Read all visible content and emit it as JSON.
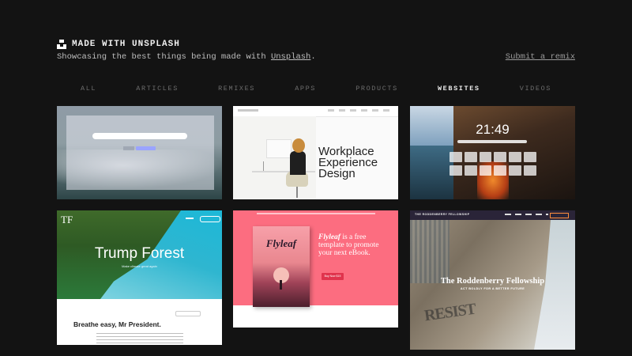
{
  "header": {
    "title": "MADE WITH UNSPLASH",
    "tagline_prefix": "Showcasing the best things being made with ",
    "tagline_link": "Unsplash",
    "tagline_suffix": ".",
    "submit_label": "Submit a remix"
  },
  "tabs": [
    {
      "label": "ALL",
      "active": false
    },
    {
      "label": "ARTICLES",
      "active": false
    },
    {
      "label": "REMIXES",
      "active": false
    },
    {
      "label": "APPS",
      "active": false
    },
    {
      "label": "PRODUCTS",
      "active": false
    },
    {
      "label": "WEBSITES",
      "active": true
    },
    {
      "label": "VIDEOS",
      "active": false
    }
  ],
  "cards": {
    "c2": {
      "headline": "Workplace Experience Design"
    },
    "c3": {
      "clock": "21:49"
    },
    "c4": {
      "logo": "TF",
      "title": "Trump Forest",
      "subtitle": "Make climate great again",
      "heading": "Breathe easy, Mr President."
    },
    "c5": {
      "book_title": "Flyleaf",
      "headline_italic": "Flyleaf",
      "headline_rest": " is a free template to promote your next eBook.",
      "cta": "Buy Now $15"
    },
    "c6": {
      "brand": "THE RODDENBERRY FELLOWSHIP",
      "title": "The Roddenberry Fellowship",
      "subtitle": "ACT BOLDLY FOR A BETTER FUTURE",
      "ground_text": "RESIST"
    }
  }
}
